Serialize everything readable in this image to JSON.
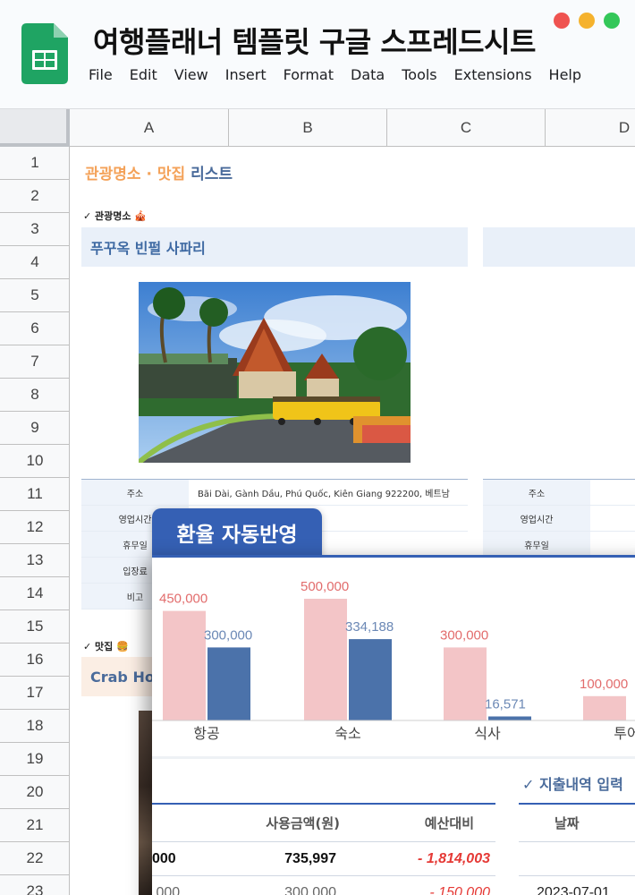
{
  "app": {
    "title": "여행플래너 템플릿 구글 스프레드시트",
    "menu": [
      "File",
      "Edit",
      "View",
      "Insert",
      "Format",
      "Data",
      "Tools",
      "Extensions",
      "Help"
    ],
    "window_dots": [
      "#ef5350",
      "#f5b22d",
      "#34c759"
    ]
  },
  "grid": {
    "columns": [
      "A",
      "B",
      "C",
      "D"
    ],
    "rows": [
      "1",
      "2",
      "3",
      "4",
      "5",
      "6",
      "7",
      "8",
      "9",
      "10",
      "11",
      "12",
      "13",
      "14",
      "15",
      "16",
      "17",
      "18",
      "19",
      "20",
      "21",
      "22",
      "23"
    ]
  },
  "sheet": {
    "list_title_part1": "관광명소 · 맛집",
    "list_title_part2": "리스트",
    "attraction_label": "✓ 관광명소 🎪",
    "attraction_name": "푸꾸옥 빈펄 사파리",
    "info_rows": [
      {
        "key": "주소",
        "value": "Bãi Dài, Gành Dầu, Phú Quốc, Kiên Giang 922200, 베트남"
      },
      {
        "key": "영업시간",
        "value": ""
      },
      {
        "key": "휴무일",
        "value": ""
      },
      {
        "key": "입장료",
        "value": ""
      },
      {
        "key": "비고",
        "value": ""
      }
    ],
    "right_info_rows": [
      {
        "key": "주소"
      },
      {
        "key": "영업시간"
      },
      {
        "key": "휴무일"
      }
    ],
    "food_label": "✓ 맛집 🍔",
    "food_name": "Crab Hou"
  },
  "overlay": {
    "tab_title": "환율 자동반영",
    "expense_title": "✓ 지출내역 입력",
    "budget_headers": [
      "사용금액(원)",
      "예산대비"
    ],
    "budget_rows": [
      {
        "col0": "000",
        "used": "735,997",
        "diff": "- 1,814,003"
      },
      {
        "col0": ",000",
        "used": "300,000",
        "diff": "- 150,000"
      }
    ],
    "date_header": "날짜",
    "date_rows": [
      "",
      "2023-07-01"
    ],
    "colors": {
      "accent": "#3560b4",
      "budget_bar": "#f3c5c7",
      "spent_bar": "#4b72aa",
      "negative": "#e53935"
    }
  },
  "chart_data": {
    "type": "bar",
    "categories": [
      "항공",
      "숙소",
      "식사",
      "투어"
    ],
    "series": [
      {
        "name": "",
        "values": [
          450000,
          500000,
          300000,
          100000
        ],
        "labels": [
          "450,000",
          "500,000",
          "300,000",
          "100,000"
        ]
      },
      {
        "name": "",
        "values": [
          300000,
          334188,
          16571,
          null
        ],
        "labels": [
          "300,000",
          "334,188",
          "16,571",
          ""
        ]
      }
    ],
    "visible_categories_note": "",
    "ylim": [
      0,
      500000
    ],
    "grid": false,
    "xlabel": "",
    "ylabel": "",
    "title": ""
  }
}
